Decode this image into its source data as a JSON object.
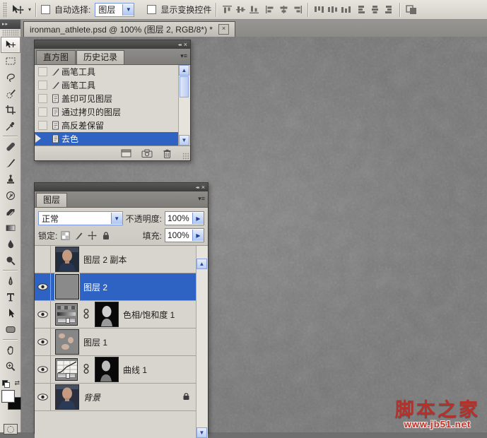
{
  "options_bar": {
    "tool_icon": "move-tool-icon",
    "auto_select": {
      "label": "自动选择:",
      "checked": false,
      "value": "图层"
    },
    "show_transform": {
      "label": "显示变换控件",
      "checked": false
    },
    "align_icons": [
      "align-top-edges",
      "align-vertical-centers",
      "align-bottom-edges",
      "align-left-edges",
      "align-horizontal-centers",
      "align-right-edges",
      "distribute-top-edges",
      "distribute-vertical-centers",
      "distribute-bottom-edges",
      "distribute-left-edges",
      "distribute-horizontal-centers",
      "distribute-right-edges",
      "auto-align-layers"
    ]
  },
  "document_tab": {
    "title": "ironman_athlete.psd @ 100% (图层 2, RGB/8*) *",
    "close": "×"
  },
  "toolbox": {
    "tools": [
      "move",
      "rectangular-marquee",
      "lasso",
      "quick-selection",
      "crop",
      "eyedropper",
      "spot-healing-brush",
      "brush",
      "clone-stamp",
      "history-brush",
      "eraser",
      "gradient",
      "blur",
      "dodge",
      "pen",
      "type",
      "path-selection",
      "shape",
      "hand",
      "zoom"
    ],
    "selected_tool": "move",
    "foreground_color": "#ffffff",
    "background_color": "#0b0b0b"
  },
  "history_panel": {
    "title_icons": {
      "collapse": "◂◂",
      "close": "×"
    },
    "tabs": [
      {
        "label": "直方图",
        "active": false
      },
      {
        "label": "历史记录",
        "active": true
      }
    ],
    "menu_icon": "▾≡",
    "items": [
      {
        "label": "画笔工具",
        "icon": "brush-icon",
        "selected": false
      },
      {
        "label": "画笔工具",
        "icon": "brush-icon",
        "selected": false
      },
      {
        "label": "盖印可见图层",
        "icon": "layer-state-icon",
        "selected": false
      },
      {
        "label": "通过拷贝的图层",
        "icon": "layer-state-icon",
        "selected": false
      },
      {
        "label": "高反差保留",
        "icon": "layer-state-icon",
        "selected": false
      },
      {
        "label": "去色",
        "icon": "layer-state-icon",
        "selected": true
      }
    ]
  },
  "layers_panel": {
    "title_icons": {
      "collapse": "◂◂",
      "close": "×"
    },
    "tab": "图层",
    "menu_icon": "▾≡",
    "blend_mode": "正常",
    "opacity": {
      "label": "不透明度:",
      "value": "100%"
    },
    "lock": {
      "label": "锁定:"
    },
    "fill": {
      "label": "填充:",
      "value": "100%"
    },
    "layers": [
      {
        "name": "图层 2 副本",
        "visible": false,
        "selected": false,
        "type": "image-portrait"
      },
      {
        "name": "图层 2",
        "visible": true,
        "selected": true,
        "type": "gray-fill"
      },
      {
        "name": "色相/饱和度 1",
        "visible": true,
        "selected": false,
        "type": "hue-saturation-adjustment",
        "has_mask": true
      },
      {
        "name": "图层 1",
        "visible": true,
        "selected": false,
        "type": "transparent-pixels"
      },
      {
        "name": "曲线 1",
        "visible": true,
        "selected": false,
        "type": "curves-adjustment",
        "has_mask": true
      },
      {
        "name": "背景",
        "visible": true,
        "selected": false,
        "type": "background",
        "locked": true
      }
    ]
  },
  "watermark": {
    "title": "脚本之家",
    "url": "www.jb51.net"
  },
  "colors": {
    "selection_blue": "#2e63c4",
    "canvas_gray": "#7e7e7e",
    "watermark_red": "#c03028"
  }
}
